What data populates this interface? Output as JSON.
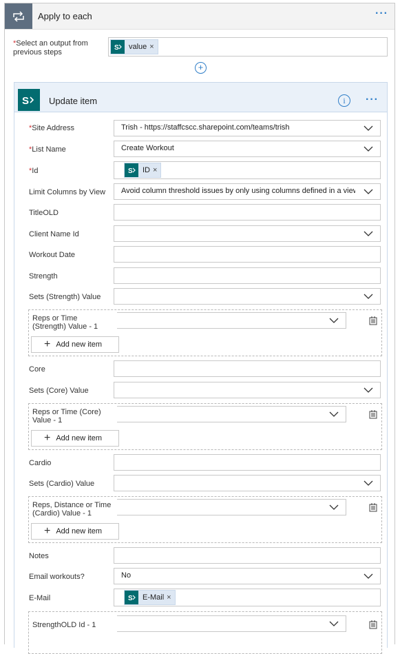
{
  "apply_each": {
    "title": "Apply to each",
    "select_label": "Select an output from previous steps",
    "token": "value"
  },
  "update_item": {
    "title": "Update item",
    "fields": {
      "site_address": {
        "label": "Site Address",
        "value": "Trish - https://staffcscc.sharepoint.com/teams/trish"
      },
      "list_name": {
        "label": "List Name",
        "value": "Create Workout"
      },
      "id": {
        "label": "Id",
        "token": "ID"
      },
      "limit_columns": {
        "label": "Limit Columns by View",
        "value": "Avoid column threshold issues by only using columns defined in a view"
      },
      "title_old": {
        "label": "TitleOLD"
      },
      "client_name_id": {
        "label": "Client Name Id"
      },
      "workout_date": {
        "label": "Workout Date"
      },
      "strength": {
        "label": "Strength"
      },
      "sets_strength": {
        "label": "Sets (Strength) Value"
      },
      "reps_strength": {
        "label": "Reps or Time (Strength) Value - 1"
      },
      "core": {
        "label": "Core"
      },
      "sets_core": {
        "label": "Sets (Core) Value"
      },
      "reps_core": {
        "label": "Reps or Time (Core) Value - 1"
      },
      "cardio": {
        "label": "Cardio"
      },
      "sets_cardio": {
        "label": "Sets (Cardio) Value"
      },
      "reps_cardio": {
        "label": "Reps, Distance or Time (Cardio) Value - 1"
      },
      "notes": {
        "label": "Notes"
      },
      "email_workouts": {
        "label": "Email workouts?",
        "value": "No"
      },
      "email": {
        "label": "E-Mail",
        "token": "E-Mail"
      },
      "strength_old": {
        "label": "StrengthOLD Id - 1"
      }
    },
    "add_new_item_label": "Add new item"
  },
  "required_marker": "*",
  "remove_glyph": "×",
  "colors": {
    "accent": "#2f7ec8",
    "sharepoint": "#036c70",
    "loop_icon_bg": "#5e6e80",
    "required": "#d13438"
  }
}
